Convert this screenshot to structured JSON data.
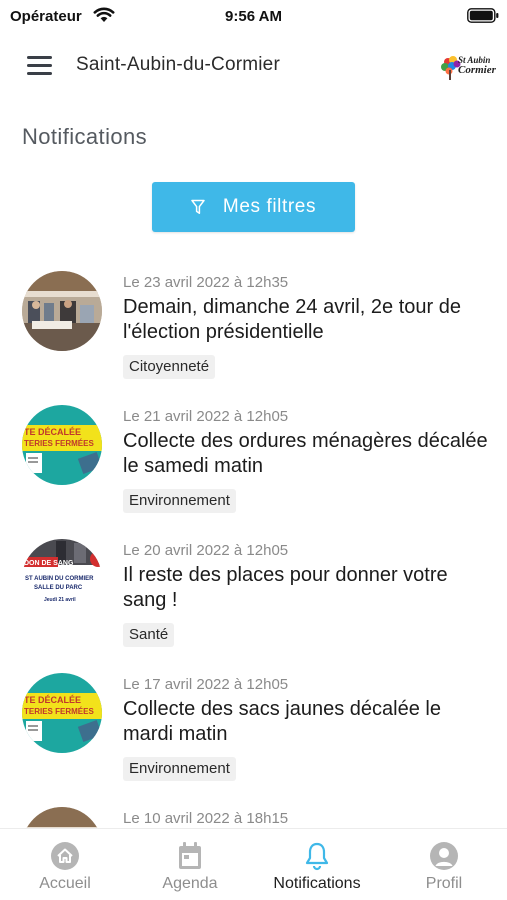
{
  "status_bar": {
    "carrier": "Opérateur",
    "time": "9:56 AM"
  },
  "header": {
    "title": "Saint-Aubin-du-Cormier",
    "logo_text_line1": "St Aubin",
    "logo_text_line2": "Cormier"
  },
  "page": {
    "title": "Notifications"
  },
  "filter_button": {
    "label": "Mes filtres"
  },
  "notifications": [
    {
      "date": "Le 23 avril 2022 à 12h35",
      "title": "Demain, dimanche 24 avril, 2e tour de l'élection présidentielle",
      "tag": "Citoyenneté",
      "thumb": "election-photo"
    },
    {
      "date": "Le 21 avril 2022 à 12h05",
      "title": "Collecte des ordures ménagères décalée le samedi matin",
      "tag": "Environnement",
      "thumb": "collecte-poster",
      "thumb_text1": "TE DÉCALÉE",
      "thumb_text2": "TERIES FERMÉES"
    },
    {
      "date": "Le 20 avril 2022 à 12h05",
      "title": "Il reste des places pour donner votre sang !",
      "tag": "Santé",
      "thumb": "don-de-sang-poster",
      "thumb_text1": "DON DE SANG",
      "thumb_text2": "ST AUBIN DU CORMIER",
      "thumb_text3": "SALLE DU PARC",
      "thumb_text4": "Jeudi 21 avril"
    },
    {
      "date": "Le 17 avril 2022 à 12h05",
      "title": "Collecte des sacs jaunes décalée le mardi matin",
      "tag": "Environnement",
      "thumb": "collecte-poster",
      "thumb_text1": "TE DÉCALÉE",
      "thumb_text2": "TERIES FERMÉES"
    },
    {
      "date": "Le 10 avril 2022 à 18h15",
      "title": "",
      "tag": "",
      "thumb": "election-photo"
    }
  ],
  "tabs": [
    {
      "label": "Accueil",
      "icon": "home-icon",
      "active": false
    },
    {
      "label": "Agenda",
      "icon": "calendar-icon",
      "active": false
    },
    {
      "label": "Notifications",
      "icon": "bell-icon",
      "active": true
    },
    {
      "label": "Profil",
      "icon": "user-icon",
      "active": false
    }
  ],
  "colors": {
    "accent": "#3fb8e8",
    "inactive_tab": "#b5b5b5",
    "active_tab_icon": "#3fb8e8"
  }
}
